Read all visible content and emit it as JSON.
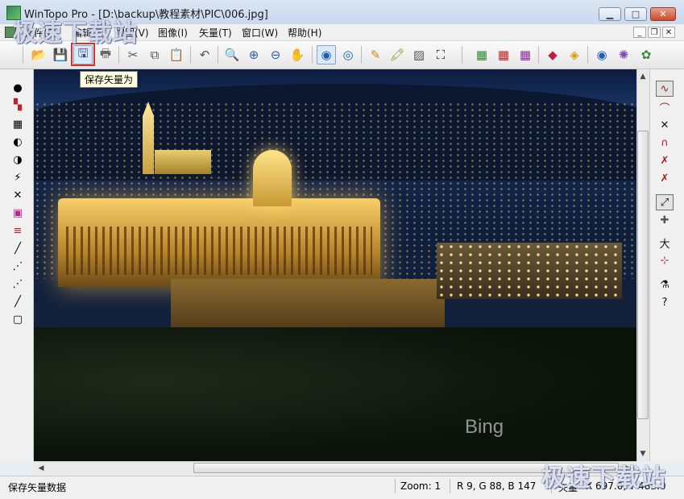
{
  "window": {
    "title": "WinTopo Pro - [D:\\backup\\教程素材\\PIC\\006.jpg]",
    "minimize_icon": "minimize-icon",
    "maximize_icon": "maximize-icon",
    "close_icon": "close-icon"
  },
  "menubar": {
    "items": [
      "文件(F)",
      "编辑(E)",
      "视图(V)",
      "图像(I)",
      "矢量(T)",
      "窗口(W)",
      "帮助(H)"
    ]
  },
  "toolbar": {
    "tooltip": "保存矢量为",
    "buttons": [
      "open-icon",
      "save-icon",
      "save-vector-icon",
      "print-icon",
      "cut-icon",
      "copy-icon",
      "paste-icon",
      "undo-icon",
      "zoom-icon",
      "zoom-in-icon",
      "zoom-out-icon",
      "pan-hand-icon",
      "view-raster-icon",
      "view-vector-icon",
      "pencil-icon",
      "highlighter-icon",
      "edit-raster-icon",
      "crop-icon",
      "vector-tool-1-icon",
      "vector-tool-2-icon",
      "vector-tool-3-icon",
      "eraser-icon",
      "layers-icon",
      "info-icon",
      "settings-icon",
      "plugin-icon"
    ]
  },
  "image": {
    "watermark_text": "Bing"
  },
  "statusbar": {
    "message": "保存矢量数据",
    "zoom": "Zoom: 1",
    "color": "R 9, G 88, B 147",
    "mode": "矢量",
    "coords": "X 697.0, Y 485.0"
  },
  "watermarks": {
    "top": "极速下载站",
    "bottom": "极速下载站"
  },
  "colors": {
    "accent_highlight": "#d9302a",
    "tooltip_bg": "#ffffe1",
    "titlebar": "#c9d8ec"
  }
}
